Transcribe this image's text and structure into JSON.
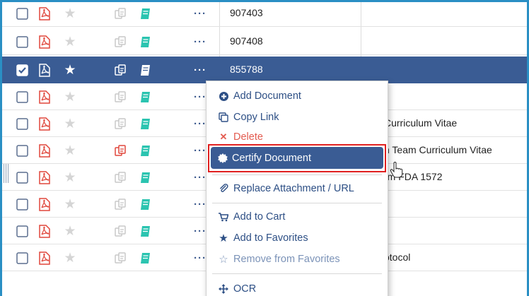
{
  "rows": [
    {
      "number": "907403",
      "description": "",
      "selected": false,
      "cert_red": false
    },
    {
      "number": "907408",
      "description": "",
      "selected": false,
      "cert_red": false
    },
    {
      "number": "855788",
      "description": "",
      "selected": true,
      "cert_red": false
    },
    {
      "number": "",
      "description": "",
      "selected": false,
      "cert_red": false
    },
    {
      "number": "",
      "description": "Curriculum Vitae",
      "selected": false,
      "cert_red": false
    },
    {
      "number": "",
      "description": "h Team Curriculum Vitae",
      "selected": false,
      "cert_red": true
    },
    {
      "number": "",
      "description": "rm FDA 1572",
      "selected": false,
      "cert_red": false
    },
    {
      "number": "",
      "description": "",
      "selected": false,
      "cert_red": false
    },
    {
      "number": "",
      "description": "",
      "selected": false,
      "cert_red": false
    },
    {
      "number": "",
      "description": "otocol",
      "selected": false,
      "cert_red": false
    }
  ],
  "menu": {
    "add_document": "Add Document",
    "copy_link": "Copy Link",
    "delete": "Delete",
    "certify_document": "Certify Document",
    "replace_attachment": "Replace Attachment / URL",
    "add_to_cart": "Add to Cart",
    "add_to_favorites": "Add to Favorites",
    "remove_from_favorites": "Remove from Favorites",
    "ocr": "OCR"
  },
  "colors": {
    "accent": "#3a5c94",
    "frame": "#2a8fc4",
    "pdf_red": "#e0473c",
    "doc_teal": "#2bc4b0",
    "highlight_border": "#e02020"
  },
  "icons": [
    "checkbox-icon",
    "pdf-icon",
    "star-icon",
    "certify-icon",
    "document-icon",
    "more-icon"
  ]
}
